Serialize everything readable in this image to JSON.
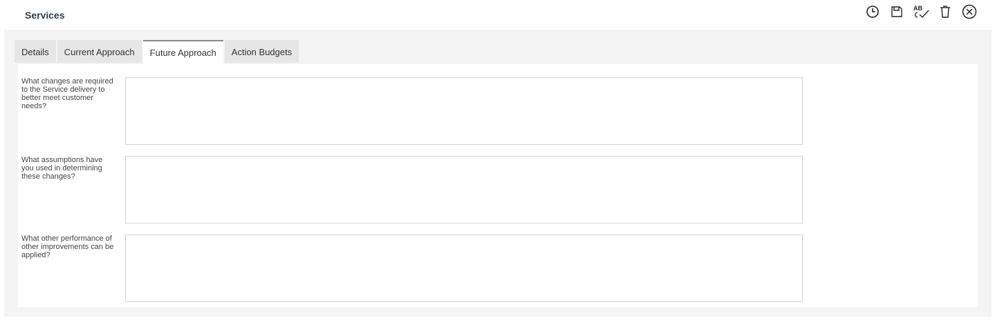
{
  "header": {
    "title": "Services"
  },
  "toolbar": {
    "icons": [
      "history-icon",
      "save-icon",
      "spellcheck-icon",
      "delete-icon",
      "close-icon"
    ],
    "spellcheck_text": "AB"
  },
  "tabs": [
    {
      "label": "Details",
      "active": false
    },
    {
      "label": "Current Approach",
      "active": false
    },
    {
      "label": "Future Approach",
      "active": true
    },
    {
      "label": "Action Budgets",
      "active": false
    }
  ],
  "fields": [
    {
      "label": "What changes are required to the Service delivery to better meet customer needs?",
      "value": ""
    },
    {
      "label": "What assumptions have you used in determining these changes?",
      "value": ""
    },
    {
      "label": "What other performance of other improvements can be applied?",
      "value": ""
    }
  ]
}
